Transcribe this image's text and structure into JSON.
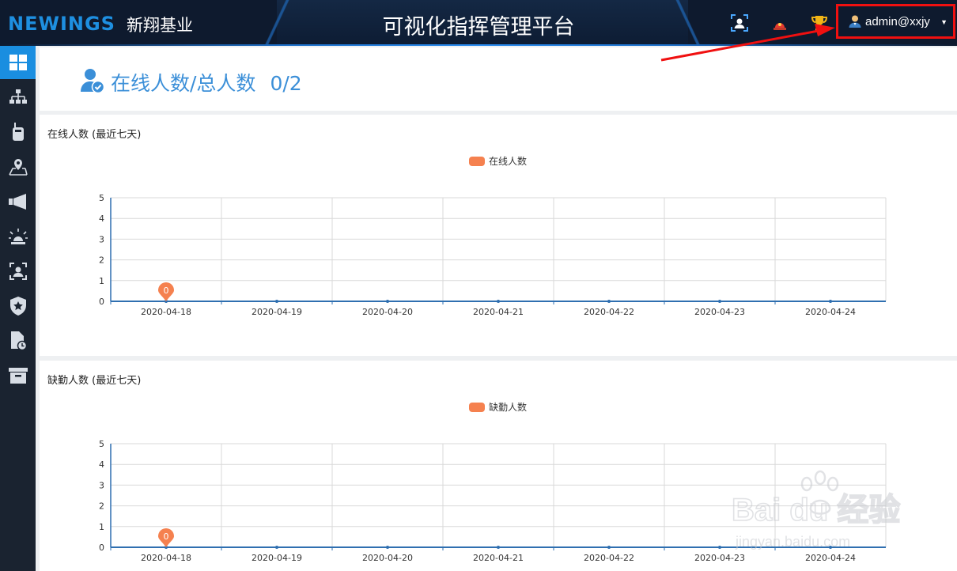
{
  "header": {
    "logo_text": "NEWINGS",
    "company": "新翔基业",
    "title": "可视化指挥管理平台",
    "username": "admin@xxjy"
  },
  "sidebar": {
    "items": [
      {
        "icon": "dashboard-icon",
        "active": true
      },
      {
        "icon": "org-chart-icon"
      },
      {
        "icon": "walkie-talkie-icon"
      },
      {
        "icon": "map-pin-icon"
      },
      {
        "icon": "megaphone-icon"
      },
      {
        "icon": "alarm-light-icon"
      },
      {
        "icon": "face-scan-icon"
      },
      {
        "icon": "shield-star-icon"
      },
      {
        "icon": "file-clock-icon"
      },
      {
        "icon": "archive-box-icon"
      }
    ]
  },
  "summary": {
    "label": "在线人数/总人数",
    "value": "0/2"
  },
  "chart_data": [
    {
      "type": "line",
      "title": "在线人数 (最近七天)",
      "categories": [
        "2020-04-18",
        "2020-04-19",
        "2020-04-20",
        "2020-04-21",
        "2020-04-22",
        "2020-04-23",
        "2020-04-24"
      ],
      "series": [
        {
          "name": "在线人数",
          "values": [
            0,
            0,
            0,
            0,
            0,
            0,
            0
          ]
        }
      ],
      "ylim": [
        0,
        5
      ],
      "yticks": [
        "0",
        "1",
        "2",
        "3",
        "4",
        "5"
      ],
      "marker_label": "0",
      "legend": "top-center",
      "color": "#f5814f"
    },
    {
      "type": "line",
      "title": "缺勤人数 (最近七天)",
      "categories": [
        "2020-04-18",
        "2020-04-19",
        "2020-04-20",
        "2020-04-21",
        "2020-04-22",
        "2020-04-23",
        "2020-04-24"
      ],
      "series": [
        {
          "name": "缺勤人数",
          "values": [
            0,
            0,
            0,
            0,
            0,
            0,
            0
          ]
        }
      ],
      "ylim": [
        0,
        5
      ],
      "yticks": [
        "0",
        "1",
        "2",
        "3",
        "4",
        "5"
      ],
      "marker_label": "0",
      "legend": "top-center",
      "color": "#f5814f"
    }
  ],
  "watermark": {
    "brand": "Bai du 经验",
    "url": "jingyan.baidu.com"
  }
}
